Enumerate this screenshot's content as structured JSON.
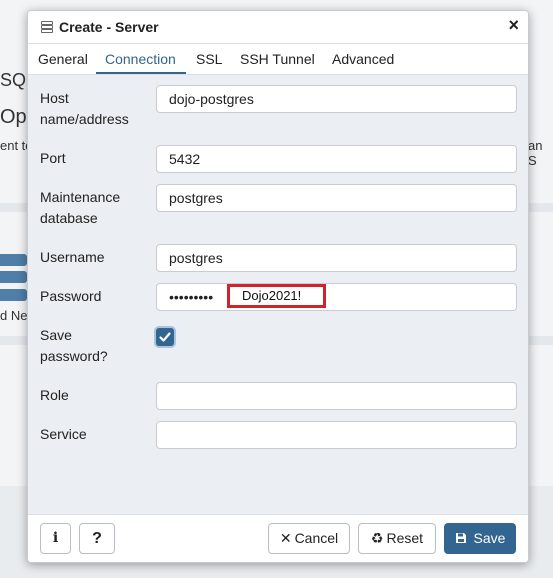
{
  "background": {
    "fragments": {
      "sql": "SQL",
      "ope": "Ope",
      "ent_to": "ent to",
      "an_s": "an S",
      "d_ne": "d Ne"
    }
  },
  "dialog": {
    "title": "Create - Server",
    "close_label": "×",
    "tabs": [
      {
        "label": "General"
      },
      {
        "label": "Connection",
        "active": true
      },
      {
        "label": "SSL"
      },
      {
        "label": "SSH Tunnel"
      },
      {
        "label": "Advanced"
      }
    ],
    "fields": {
      "host": {
        "label_line1": "Host",
        "label_line2": "name/address",
        "value": "dojo-postgres"
      },
      "port": {
        "label": "Port",
        "value": "5432"
      },
      "maintenance_db": {
        "label_line1": "Maintenance",
        "label_line2": "database",
        "value": "postgres"
      },
      "username": {
        "label": "Username",
        "value": "postgres"
      },
      "password": {
        "label": "Password",
        "masked_value": "•••••••••",
        "annotation": "Dojo2021!"
      },
      "save_password": {
        "label_line1": "Save",
        "label_line2": "password?",
        "checked": true
      },
      "role": {
        "label": "Role",
        "value": ""
      },
      "service": {
        "label": "Service",
        "value": ""
      }
    },
    "footer": {
      "info_label": "i",
      "help_label": "?",
      "cancel_label": "Cancel",
      "reset_label": "Reset",
      "save_label": "Save"
    }
  },
  "colors": {
    "accent": "#326690",
    "annotation_border": "#d2232a",
    "background": "#f3f4f6"
  }
}
